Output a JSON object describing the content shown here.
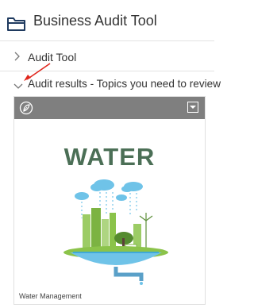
{
  "header": {
    "title": "Business Audit Tool",
    "icon": "folder-icon",
    "icon_color": "#1f3a5f"
  },
  "sections": [
    {
      "label": "Audit Tool",
      "state": "collapsed",
      "icon": "chevron-right-icon"
    },
    {
      "label": "Audit results - Topics you need to review",
      "state": "expanded",
      "icon": "chevron-down-icon"
    }
  ],
  "annotation": {
    "icon": "red-arrow-icon",
    "color": "#e0261c"
  },
  "card": {
    "image_title": "WATER",
    "caption": "Water Management",
    "header_bar_color": "#7f7f7f",
    "logo_icon": "leaf-circle-icon",
    "menu_icon": "dropdown-menu-icon",
    "accent_color": "#4b6f56"
  }
}
